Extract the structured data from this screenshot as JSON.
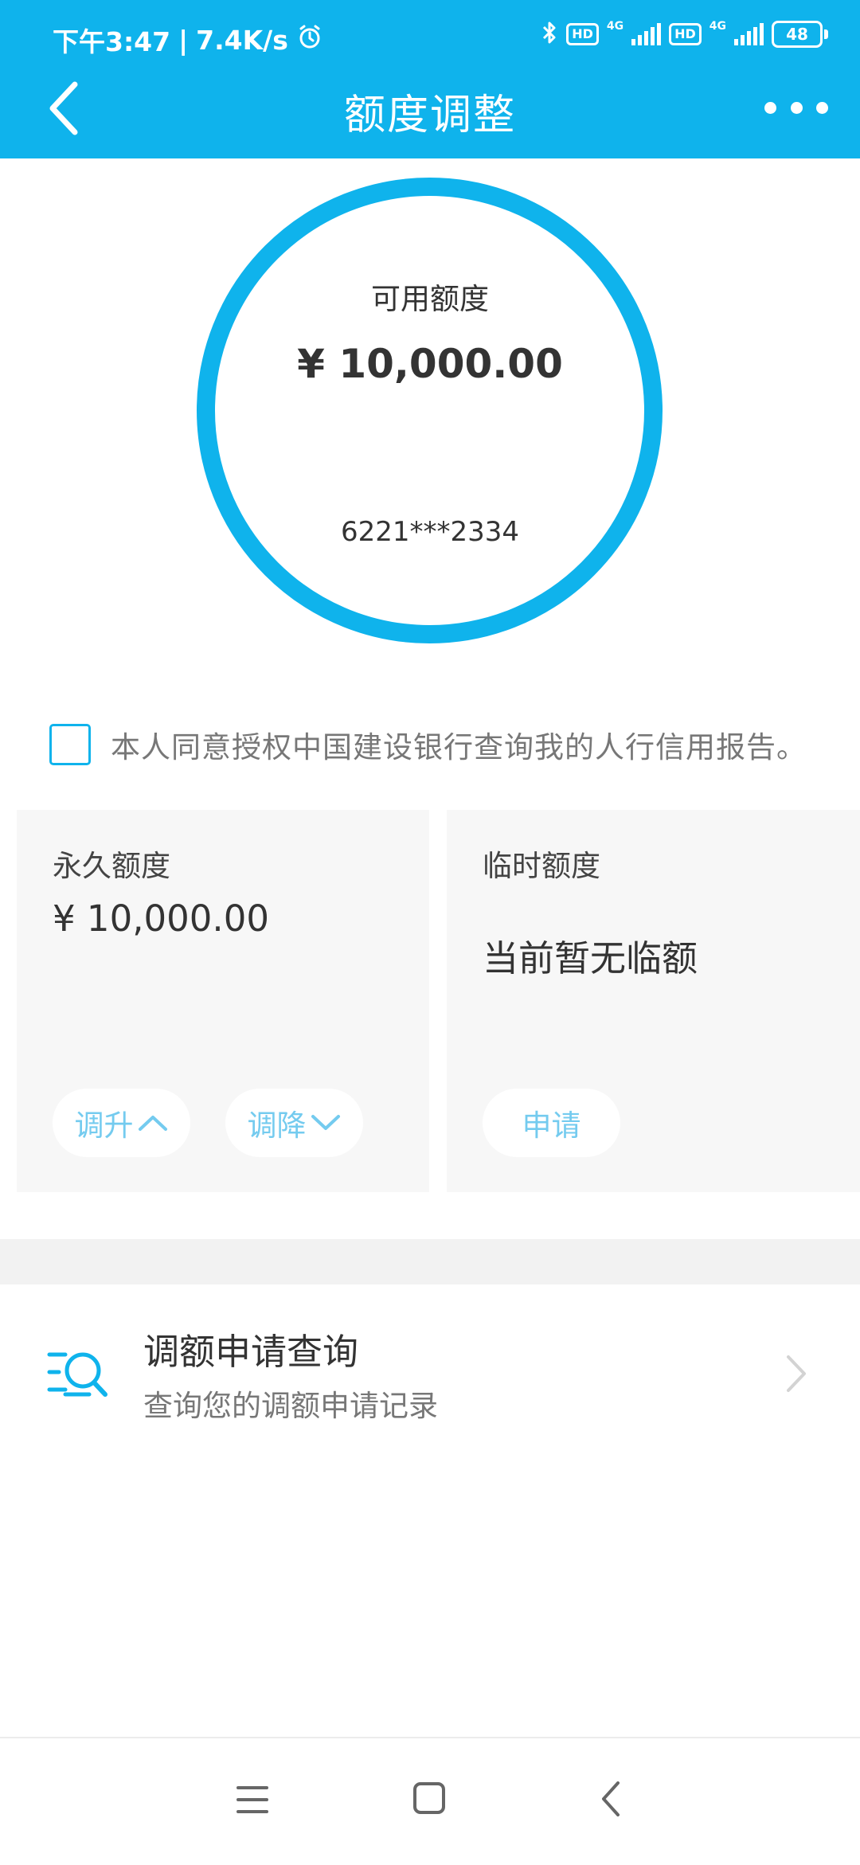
{
  "status_bar": {
    "time": "下午3:47",
    "separator": "|",
    "speed": "7.4K/s",
    "hd1": "HD",
    "net1": "4G",
    "hd2": "HD",
    "net2": "4G",
    "battery": "48"
  },
  "nav": {
    "title": "额度调整"
  },
  "limit_ring": {
    "label": "可用额度",
    "amount": "¥ 10,000.00",
    "card_number": "6221***2334"
  },
  "agreement": {
    "text": "本人同意授权中国建设银行查询我的人行信用报告。",
    "checked": false
  },
  "permanent": {
    "title": "永久额度",
    "amount": "¥ 10,000.00",
    "increase_label": "调升",
    "decrease_label": "调降"
  },
  "temporary": {
    "title": "临时额度",
    "status": "当前暂无临额",
    "apply_label": "申请"
  },
  "record": {
    "title": "调额申请查询",
    "subtitle": "查询您的调额申请记录"
  },
  "colors": {
    "accent": "#0fb3ec",
    "pill_text": "#74cbef",
    "card_bg": "#f7f7f7"
  },
  "icons": [
    "chevron-left-icon",
    "more-icon",
    "alarm-icon",
    "bluetooth-icon",
    "signal-icon",
    "battery-icon",
    "chevron-up-icon",
    "chevron-down-icon",
    "search-list-icon",
    "chevron-right-icon",
    "menu-icon",
    "home-icon",
    "back-icon"
  ]
}
